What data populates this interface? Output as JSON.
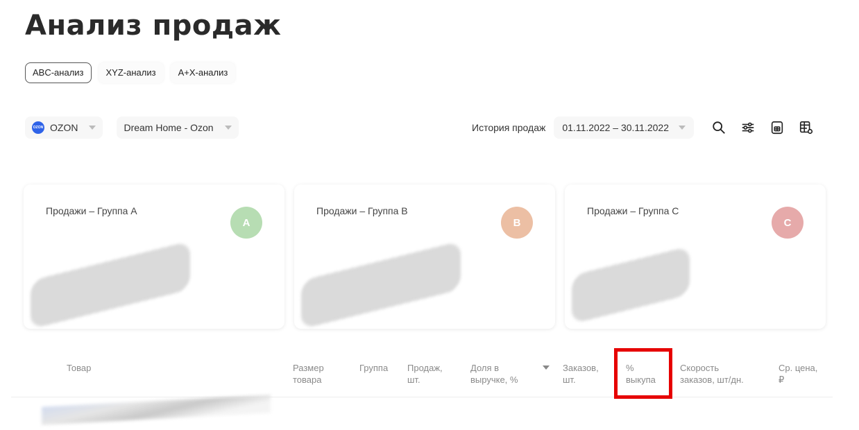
{
  "page_title": "Анализ продаж",
  "tabs": [
    {
      "label": "ABC-анализ",
      "active": true
    },
    {
      "label": "XYZ-анализ",
      "active": false
    },
    {
      "label": "A+X-анализ",
      "active": false
    }
  ],
  "filters": {
    "marketplace": {
      "label": "OZON",
      "logo_text": "OZON"
    },
    "store": {
      "label": "Dream Home - Ozon"
    }
  },
  "history": {
    "label": "История продаж",
    "date_range": "01.11.2022 – 30.11.2022"
  },
  "cards": [
    {
      "label": "Продажи – Группа A",
      "badge": "A",
      "badge_color": "#b7ddb3"
    },
    {
      "label": "Продажи – Группа B",
      "badge": "B",
      "badge_color": "#ecbfa4"
    },
    {
      "label": "Продажи – Группа C",
      "badge": "C",
      "badge_color": "#e6aaaa"
    }
  ],
  "table": {
    "columns": [
      {
        "line1": "Товар",
        "line2": ""
      },
      {
        "line1": "Размер",
        "line2": "товара"
      },
      {
        "line1": "Группа",
        "line2": ""
      },
      {
        "line1": "Продаж,",
        "line2": "шт."
      },
      {
        "line1": "Доля в",
        "line2": "выручке, %"
      },
      {
        "line1": "Заказов,",
        "line2": "шт."
      },
      {
        "line1": "%",
        "line2": "выкупа"
      },
      {
        "line1": "Скорость",
        "line2": "заказов, шт/дн."
      },
      {
        "line1": "Ср. цена,",
        "line2": "₽"
      }
    ]
  },
  "colors": {
    "highlight": "#e60000",
    "ozon_blue": "#2f63e8"
  },
  "icons": [
    "search-icon",
    "filter-sliders-icon",
    "export-excel-icon",
    "table-settings-icon"
  ]
}
